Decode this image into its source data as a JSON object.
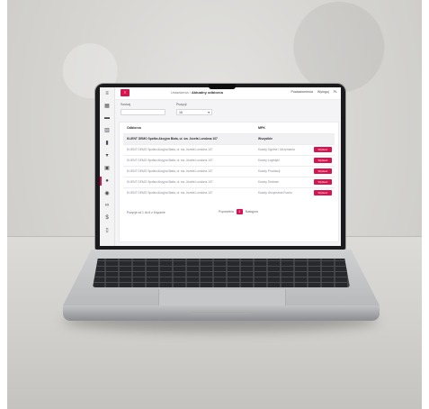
{
  "topbar": {
    "brand": "≡",
    "crumb_parent": "Ustawienia",
    "crumb_sep": "/",
    "crumb_current": "Aktualny odbiorca",
    "right_1": "Powiadomienia",
    "right_2": "Wyloguj",
    "right_3": "PL"
  },
  "filters": {
    "search_label": "Szukaj",
    "search_value": "",
    "perpage_label": "Pozycji",
    "perpage_value": "10"
  },
  "table": {
    "col_a": "Odbiorca",
    "col_b": "MPK",
    "rows": [
      {
        "a": "KLIENT DEMO Spółka Akcyjna Biała, ul. św. Józefa Londona 107",
        "b": "Wszystkie",
        "btn": ""
      },
      {
        "a": "KLIENT DEMO Spółka Akcyjna Biała, ul. św. Józefa Londona 107",
        "b": "Koszty Ogólne i Utrzymania",
        "btn": "Wybierz"
      },
      {
        "a": "KLIENT DEMO Spółka Akcyjna Biała, ul. św. Józefa Londona 107",
        "b": "Koszty Logistyki",
        "btn": "Wybierz"
      },
      {
        "a": "KLIENT DEMO Spółka Akcyjna Biała, ul. św. Józefa Londona 107",
        "b": "Koszty Produkcji",
        "btn": "Wybierz"
      },
      {
        "a": "KLIENT DEMO Spółka Akcyjna Biała, ul. św. Józefa Londona 107",
        "b": "Koszty Testowe",
        "btn": "Wybierz"
      },
      {
        "a": "KLIENT DEMO Spółka Akcyjna Biała, ul. św. Józefa Londona 107",
        "b": "Koszty Utrzymania Ruchu",
        "btn": "Wybierz"
      }
    ],
    "footer_info": "Pozycje od 1 do 6 z 6 łącznie",
    "prev": "Poprzednia",
    "page": "1",
    "next": "Następna"
  },
  "sidebar_icons": [
    "menu-icon",
    "grid-icon",
    "truck-icon",
    "calendar-icon",
    "document-icon",
    "cart-icon",
    "box-icon",
    "user-icon",
    "eye-icon",
    "link-icon",
    "dollar-icon",
    "file-icon"
  ],
  "colors": {
    "accent": "#d9134f"
  }
}
